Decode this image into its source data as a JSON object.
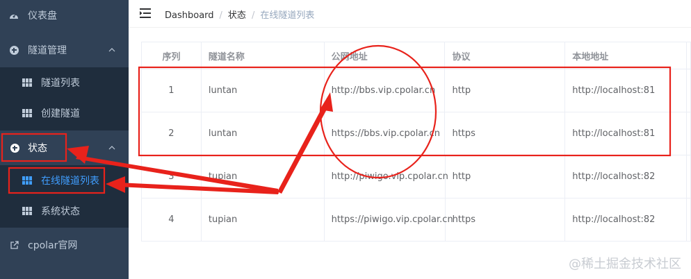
{
  "sidebar": {
    "items": [
      {
        "label": "仪表盘",
        "icon": "dashboard-icon"
      },
      {
        "label": "隧道管理",
        "icon": "plus-circle-icon"
      },
      {
        "label": "隧道列表",
        "icon": "table-grid-icon"
      },
      {
        "label": "创建隧道",
        "icon": "table-grid-icon"
      },
      {
        "label": "状态",
        "icon": "plus-circle-icon"
      },
      {
        "label": "在线隧道列表",
        "icon": "table-grid-icon"
      },
      {
        "label": "系统状态",
        "icon": "table-grid-icon"
      },
      {
        "label": "cpolar官网",
        "icon": "external-link-icon"
      }
    ],
    "colors": {
      "bg": "#304156",
      "submenu_bg": "#1f2d3d",
      "text": "#bfcbd9",
      "active": "#409eff"
    }
  },
  "header": {
    "breadcrumb": [
      "Dashboard",
      "状态",
      "在线隧道列表"
    ],
    "separator": "/"
  },
  "table": {
    "columns": [
      "序列",
      "隧道名称",
      "公网地址",
      "协议",
      "本地地址"
    ],
    "rows": [
      {
        "index": "1",
        "name": "luntan",
        "public_url": "http://bbs.vip.cpolar.cn",
        "protocol": "http",
        "local": "http://localhost:81"
      },
      {
        "index": "2",
        "name": "luntan",
        "public_url": "https://bbs.vip.cpolar.cn",
        "protocol": "https",
        "local": "http://localhost:81"
      },
      {
        "index": "3",
        "name": "tupian",
        "public_url": "http://piwigo.vip.cpolar.cn",
        "protocol": "http",
        "local": "http://localhost:82"
      },
      {
        "index": "4",
        "name": "tupian",
        "public_url": "https://piwigo.vip.cpolar.cn",
        "protocol": "https",
        "local": "http://localhost:82"
      }
    ]
  },
  "annotation_color": "#e8221b",
  "watermark": "@稀土掘金技术社区"
}
